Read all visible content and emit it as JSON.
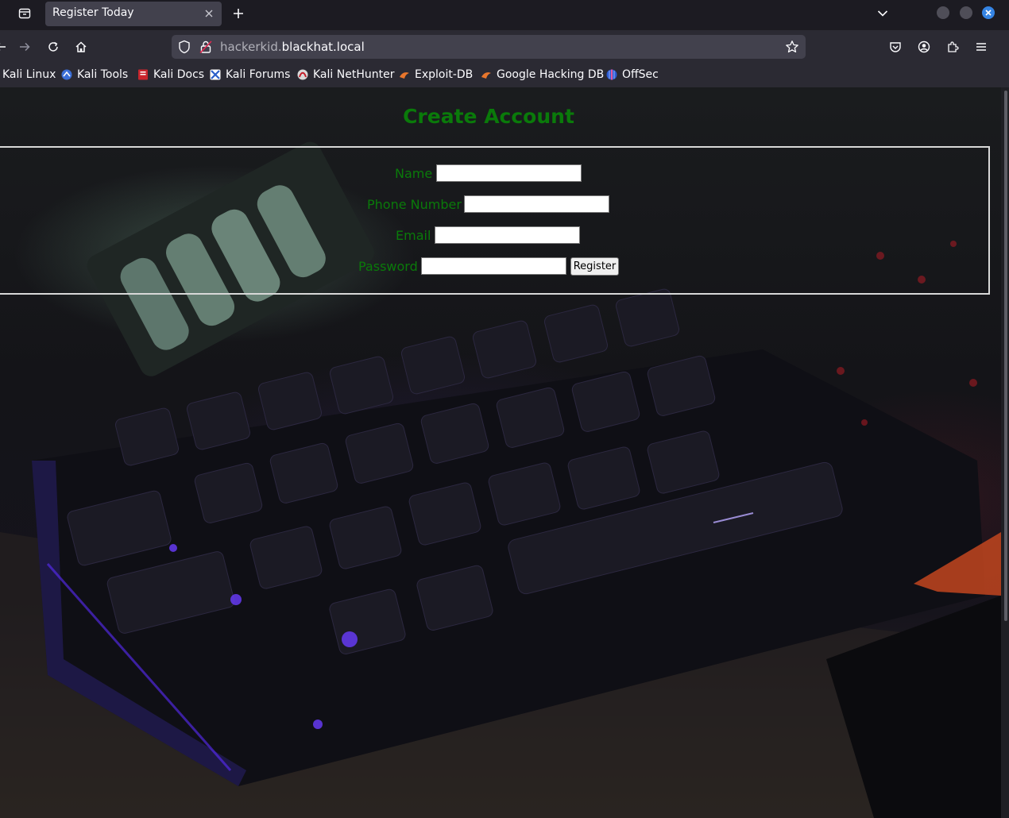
{
  "browser": {
    "tab": {
      "title": "Register Today"
    },
    "url": {
      "prefix": "hackerkid.",
      "host": "blackhat.local"
    },
    "bookmarks": [
      {
        "label": "Kali Linux",
        "icon": "kali-icon"
      },
      {
        "label": "Kali Tools",
        "icon": "kali-tools-icon"
      },
      {
        "label": "Kali Docs",
        "icon": "kali-docs-icon"
      },
      {
        "label": "Kali Forums",
        "icon": "kali-forums-icon"
      },
      {
        "label": "Kali NetHunter",
        "icon": "nethunter-icon"
      },
      {
        "label": "Exploit-DB",
        "icon": "exploit-db-icon"
      },
      {
        "label": "Google Hacking DB",
        "icon": "ghdb-icon"
      },
      {
        "label": "OffSec",
        "icon": "offsec-icon"
      }
    ]
  },
  "page": {
    "heading": "Create Account",
    "form": {
      "name_label": "Name",
      "phone_label": "Phone Number",
      "email_label": "Email",
      "password_label": "Password",
      "submit_label": "Register"
    },
    "colors": {
      "label_green": "#0a7a0a",
      "box_border": "#d8d8d8"
    }
  }
}
